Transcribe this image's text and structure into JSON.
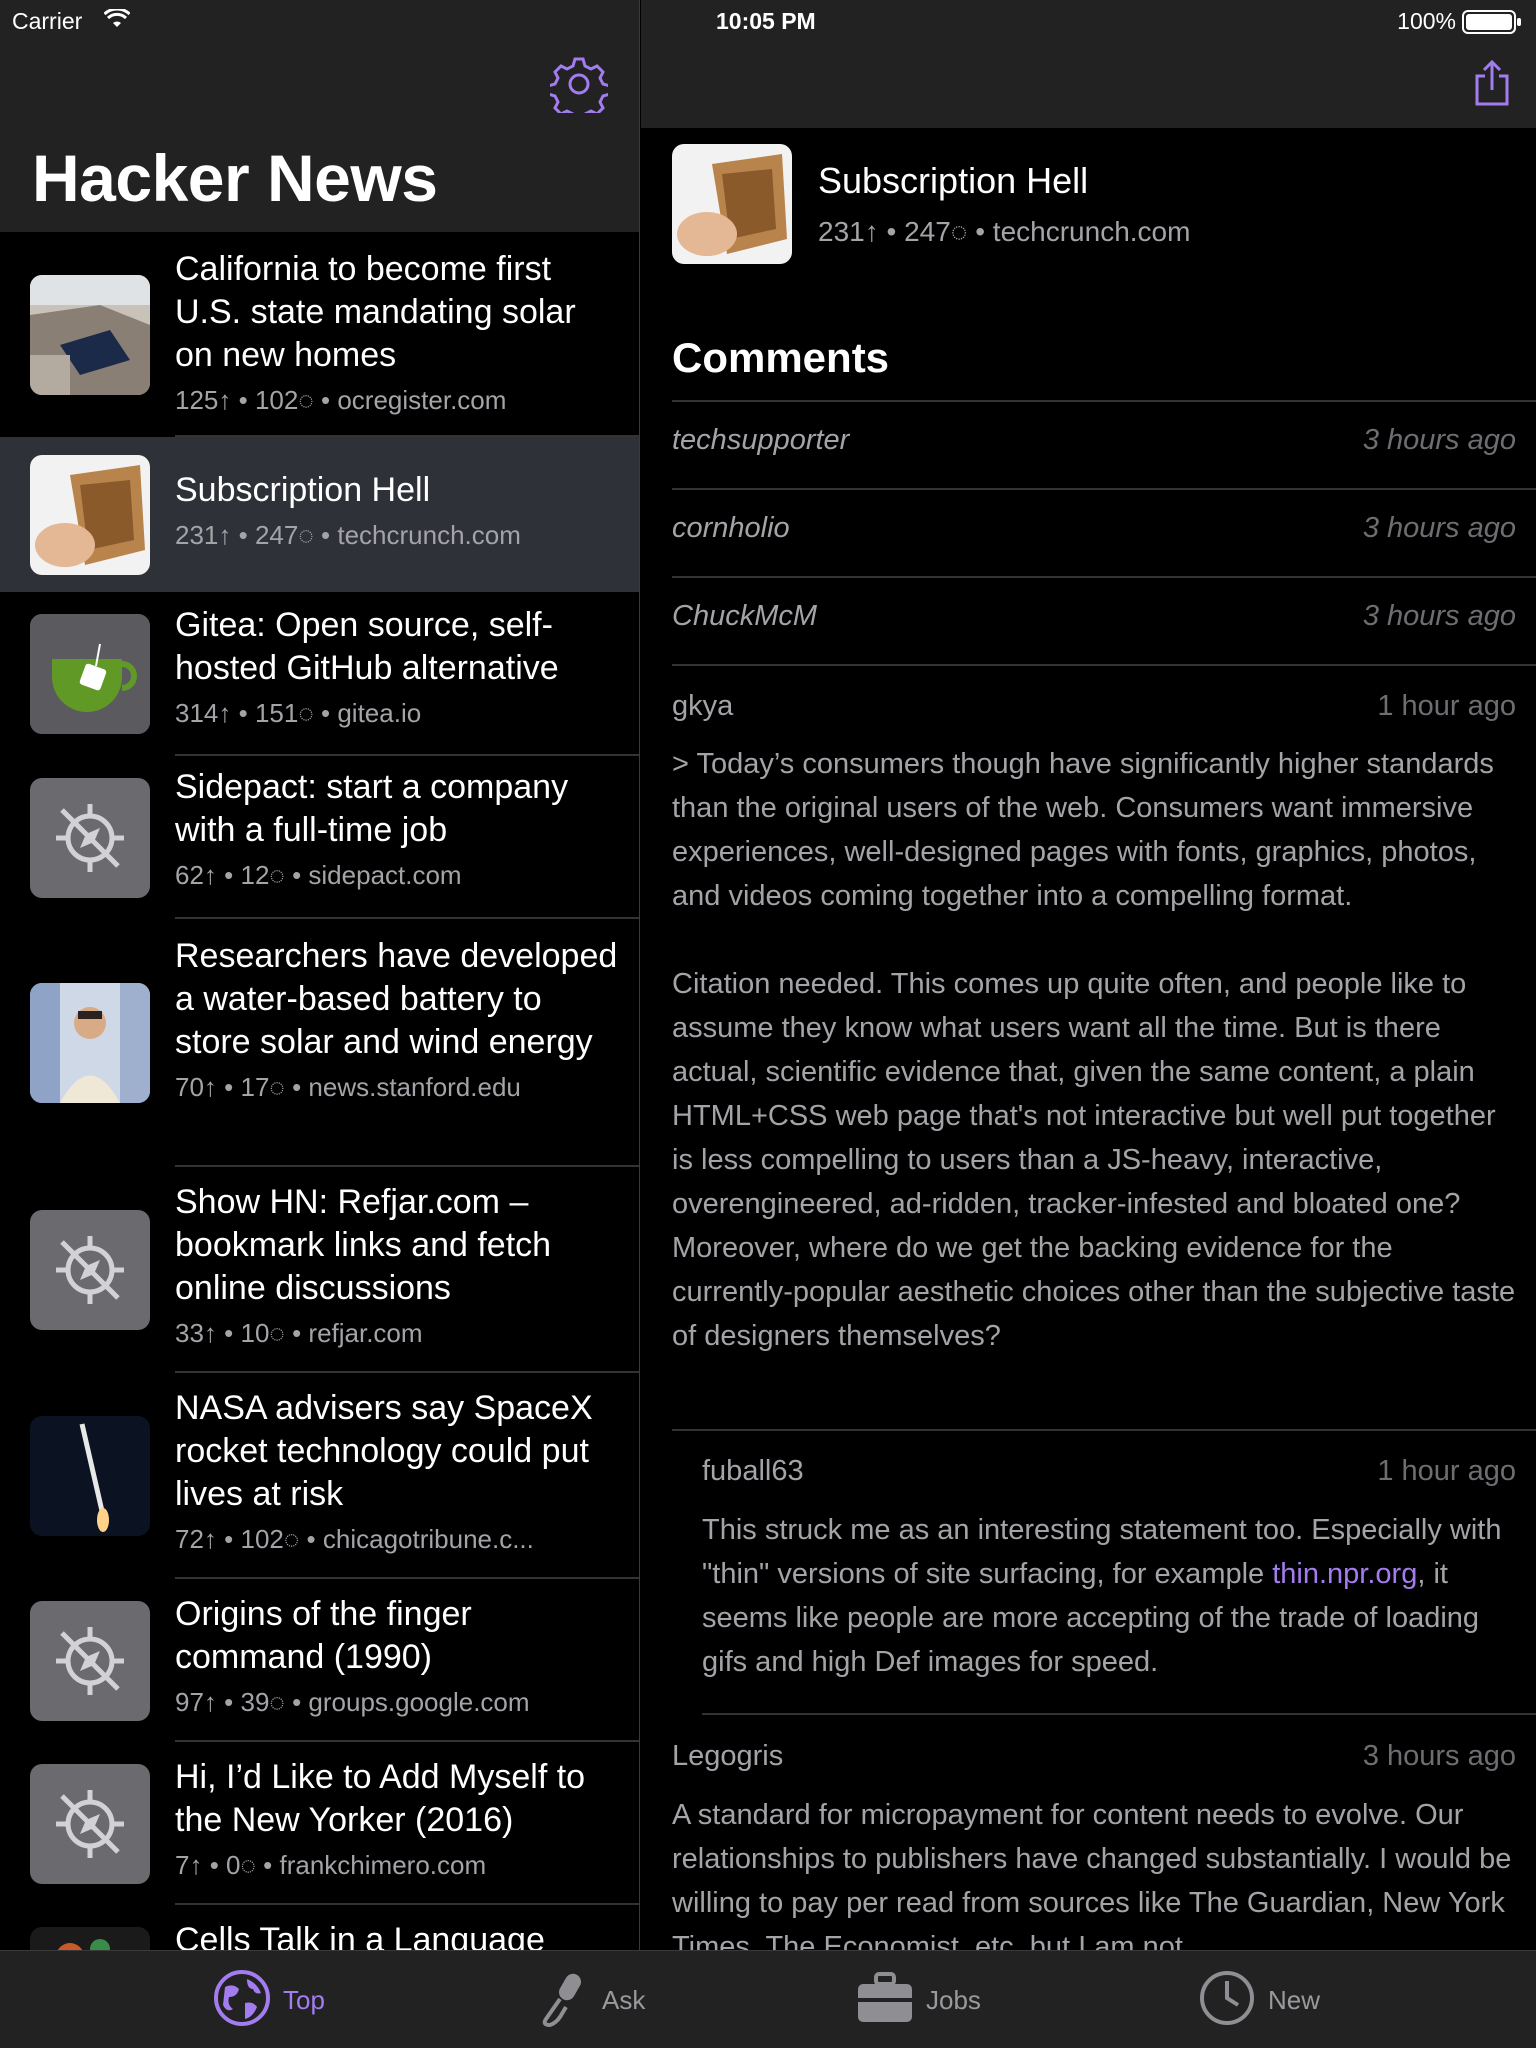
{
  "status_bar": {
    "carrier": "Carrier",
    "time": "10:05 PM",
    "battery": "100%"
  },
  "sidebar": {
    "title": "Hacker News",
    "stories": [
      {
        "title": "California to become first U.S. state mandating solar on new homes",
        "points": "125",
        "comments": "102",
        "domain": "ocregister.com",
        "thumb": "solar"
      },
      {
        "title": "Subscription Hell",
        "points": "231",
        "comments": "247",
        "domain": "techcrunch.com",
        "thumb": "wallet",
        "selected": true
      },
      {
        "title": "Gitea: Open source, self-hosted GitHub alternative",
        "points": "314",
        "comments": "151",
        "domain": "gitea.io",
        "thumb": "gitea"
      },
      {
        "title": "Sidepact: start a company with a full-time job",
        "points": "62",
        "comments": "12",
        "domain": "sidepact.com",
        "thumb": "placeholder"
      },
      {
        "title": "Researchers have developed a water-based battery to store solar and wind energy",
        "points": "70",
        "comments": "17",
        "domain": "news.stanford.edu",
        "thumb": "person"
      },
      {
        "title": "Show HN: Refjar.com – bookmark links and fetch online discussions",
        "points": "33",
        "comments": "10",
        "domain": "refjar.com",
        "thumb": "placeholder"
      },
      {
        "title": "NASA advisers say SpaceX rocket technology could put lives at risk",
        "points": "72",
        "comments": "102",
        "domain": "chicagotribune.c...",
        "thumb": "rocket"
      },
      {
        "title": "Origins of the finger command (1990)",
        "points": "97",
        "comments": "39",
        "domain": "groups.google.com",
        "thumb": "placeholder"
      },
      {
        "title": "Hi, I’d Like to Add Myself to the New Yorker (2016)",
        "points": "7",
        "comments": "0",
        "domain": "frankchimero.com",
        "thumb": "placeholder"
      },
      {
        "title": "Cells Talk in a Language",
        "points": "",
        "comments": "",
        "domain": "",
        "thumb": "cells"
      }
    ]
  },
  "detail": {
    "title": "Subscription Hell",
    "meta": "231↑ • 247◌ • techcrunch.com",
    "comments_heading": "Comments",
    "comments": [
      {
        "author": "techsupporter",
        "time": "3 hours ago",
        "collapsed": true
      },
      {
        "author": "cornholio",
        "time": "3 hours ago",
        "collapsed": true
      },
      {
        "author": "ChuckMcM",
        "time": "3 hours ago",
        "collapsed": true
      },
      {
        "author": "gkya",
        "time": "1 hour ago",
        "p1": "> Today’s consumers though have significantly higher standards than the original users of the web. Consumers want immersive experiences, well-designed pages with fonts, graphics, photos, and videos coming together into a compelling format.",
        "p2": "Citation needed.  This comes up quite often, and people like to assume they know what users want all the time.  But is there actual, scientific evidence that, given the same content, a plain HTML+CSS web page that's not interactive but well put together is less compelling to users than a JS-heavy, interactive, overengineered, ad-ridden, tracker-infested and bloated one?  Moreover, where do we get the backing evidence for the currently-popular aesthetic choices other than the subjective taste of designers themselves?"
      },
      {
        "author": "fuball63",
        "time": "1 hour ago",
        "p1_before": "This struck me as an interesting statement too. Especially with \"thin\" versions of site surfacing, for example ",
        "link": "thin.npr.org",
        "p1_after": ", it seems like people are more accepting of the trade of loading gifs and high Def images for speed."
      },
      {
        "author": "Legogris",
        "time": "3 hours ago",
        "p1": "A standard for micropayment for content needs to evolve. Our relationships to publishers have changed substantially. I would be willing to pay per read from sources like The Guardian, New York Times, The Economist, etc, but I am not"
      }
    ]
  },
  "tabs": [
    {
      "label": "Top",
      "icon": "globe-icon",
      "active": true
    },
    {
      "label": "Ask",
      "icon": "microphone-icon",
      "active": false
    },
    {
      "label": "Jobs",
      "icon": "briefcase-icon",
      "active": false
    },
    {
      "label": "New",
      "icon": "clock-icon",
      "active": false
    }
  ],
  "colors": {
    "accent": "#a37cf0",
    "header_bg": "#222222",
    "selected_row": "#2f3138",
    "meta_text": "#a4a4a8"
  }
}
